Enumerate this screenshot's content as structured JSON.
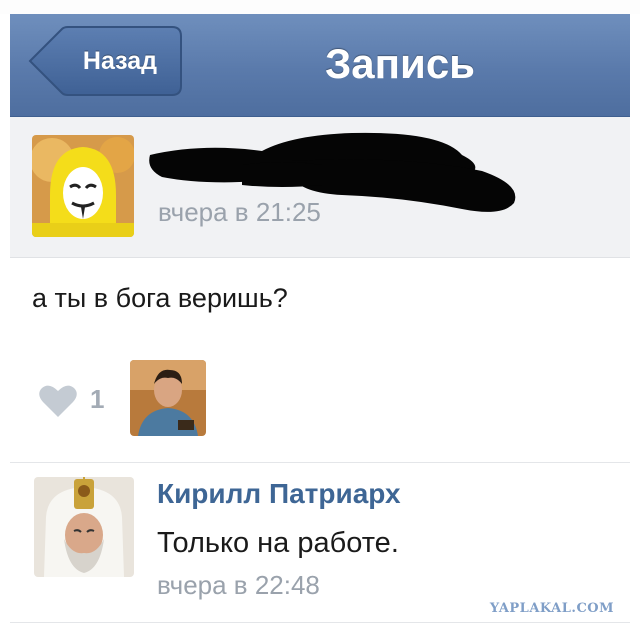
{
  "navbar": {
    "back_label": "Назад",
    "title": "Запись",
    "color": "#5a7aab"
  },
  "post": {
    "author_avatar_icon": "masked-person-avatar",
    "time": "вчера в 21:25",
    "text": "а ты в бога веришь?",
    "likes": {
      "icon": "heart-icon",
      "count": "1"
    }
  },
  "comment": {
    "author": "Кирилл Патриарх",
    "text": "Только на работе.",
    "time": "вчера в 22:48",
    "author_color": "#3e6695"
  },
  "watermark": "YAPLAKAL.COM"
}
